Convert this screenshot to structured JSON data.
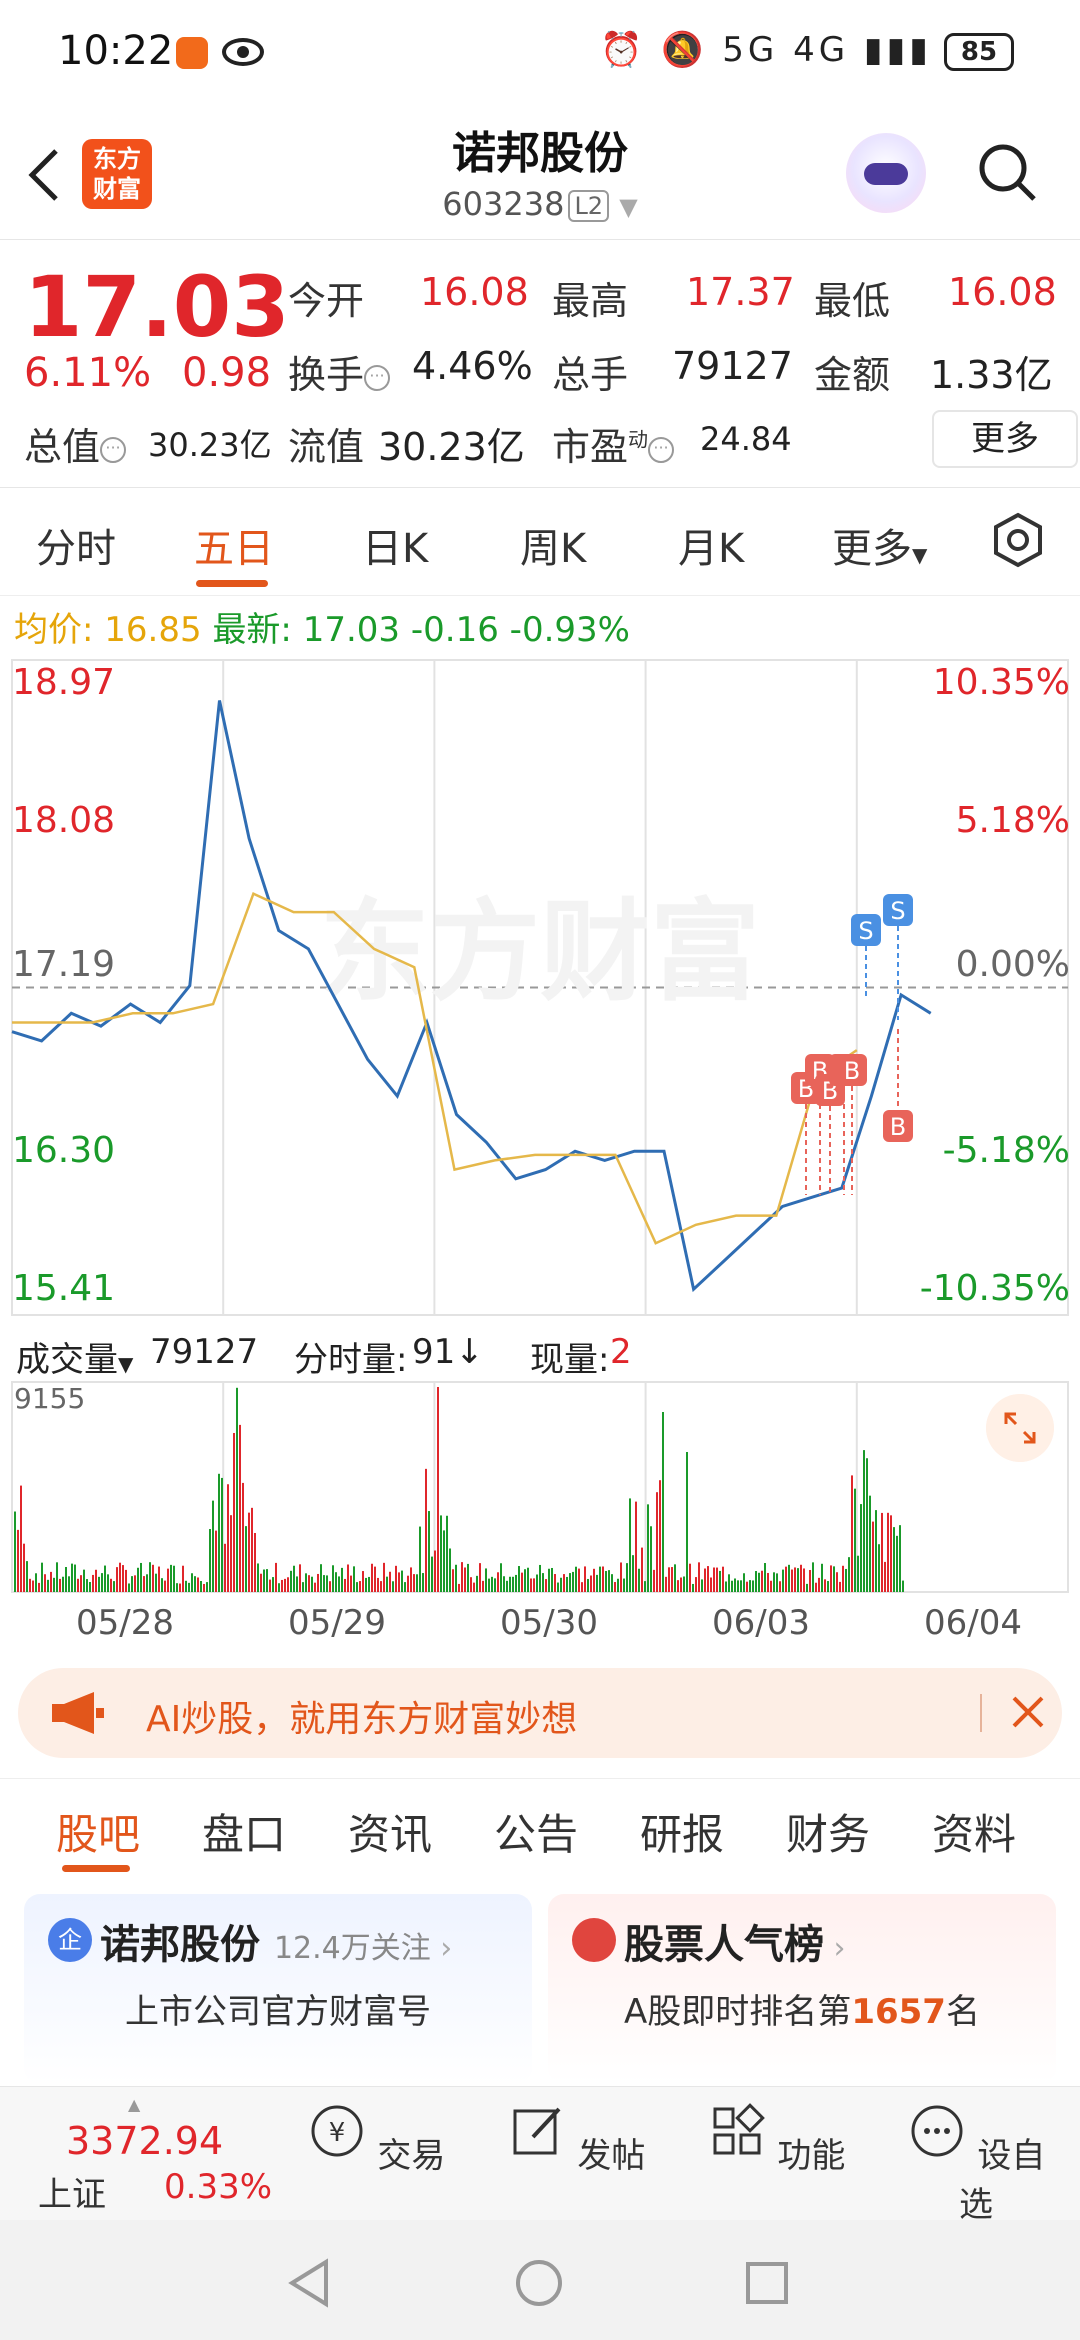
{
  "status": {
    "time": "10:22",
    "battery": "85",
    "signal_text": "5G 4G"
  },
  "header": {
    "logo_text": "东方财富",
    "title": "诺邦股份",
    "code": "603238",
    "level": "L2"
  },
  "quote": {
    "price": "17.03",
    "change_pct": "6.11%",
    "change": "0.98",
    "open_label": "今开",
    "open": "16.08",
    "high_label": "最高",
    "high": "17.37",
    "low_label": "最低",
    "low": "16.08",
    "turnover_label": "换手",
    "turnover": "4.46%",
    "volume_label": "总手",
    "volume": "79127",
    "amount_label": "金额",
    "amount": "1.33亿",
    "mktcap_label": "总值",
    "mktcap": "30.23亿",
    "float_label": "流值",
    "float": "30.23亿",
    "pe_label": "市盈",
    "pe_sup": "动",
    "pe": "24.84",
    "more": "更多"
  },
  "chart_tabs": {
    "items": [
      "分时",
      "五日",
      "日K",
      "周K",
      "月K",
      "更多"
    ],
    "active": "五日"
  },
  "info": {
    "avg_label": "均价:",
    "avg": "16.85",
    "latest_label": "最新:",
    "latest": "17.03",
    "diff": "-0.16",
    "diff_pct": "-0.93%"
  },
  "chart_data": {
    "type": "line",
    "x": [
      "05/28",
      "05/29",
      "05/30",
      "06/03",
      "06/04"
    ],
    "ylim": [
      15.41,
      18.97
    ],
    "y_ticks_left": [
      "18.97",
      "18.08",
      "17.19",
      "16.30",
      "15.41"
    ],
    "y_ticks_right": [
      "10.35%",
      "5.18%",
      "0.00%",
      "-5.18%",
      "-10.35%"
    ],
    "watermark": "东方财富",
    "series": [
      {
        "values": [
          16.95,
          16.9,
          17.05,
          16.98,
          17.1,
          17.0,
          17.2,
          18.75,
          18.0,
          17.5,
          17.4,
          17.1,
          16.8,
          16.6,
          17.0,
          16.5,
          16.35,
          16.15,
          16.2,
          16.3,
          16.25,
          16.3,
          16.3,
          15.55,
          15.7,
          15.85,
          16.0,
          16.05,
          16.1,
          16.6,
          17.15,
          17.05
        ]
      },
      {
        "values": [
          17.0,
          17.0,
          17.0,
          17.05,
          17.05,
          17.1,
          17.7,
          17.6,
          17.6,
          17.4,
          17.3,
          16.2,
          16.25,
          16.28,
          16.28,
          16.28,
          15.8,
          15.9,
          15.95,
          15.95,
          16.7,
          16.85
        ]
      }
    ],
    "markers": [
      "S",
      "S",
      "B",
      "B",
      "B",
      "B",
      "B",
      "B"
    ]
  },
  "volume_bar": {
    "label": "成交量",
    "value": "79127",
    "tick_label": "分时量:",
    "tick_value": "91",
    "now_label": "现量:",
    "now_value": "2",
    "max": "9155"
  },
  "banner": {
    "text": "AI炒股，就用东方财富妙想"
  },
  "sub_tabs": {
    "items": [
      "股吧",
      "盘口",
      "资讯",
      "公告",
      "研报",
      "财务",
      "资料"
    ],
    "active": "股吧"
  },
  "cards": [
    {
      "icon_text": "企",
      "title": "诺邦股份",
      "follow": "12.4万关注",
      "sub": "上市公司官方财富号"
    },
    {
      "title": "股票人气榜",
      "sub_prefix": "A股即时排名第",
      "rank": "1657",
      "sub_suffix": "名"
    }
  ],
  "bottom_nav": {
    "index_value": "3372.94",
    "index_name": "上证",
    "index_pct": "0.33%",
    "items": [
      "交易",
      "发帖",
      "功能",
      "设自选"
    ]
  },
  "colors": {
    "up": "#e0262b",
    "down": "#1a9a2a",
    "accent": "#e2561b",
    "avg_line": "#e5b84a",
    "price_line": "#2f6db3"
  }
}
